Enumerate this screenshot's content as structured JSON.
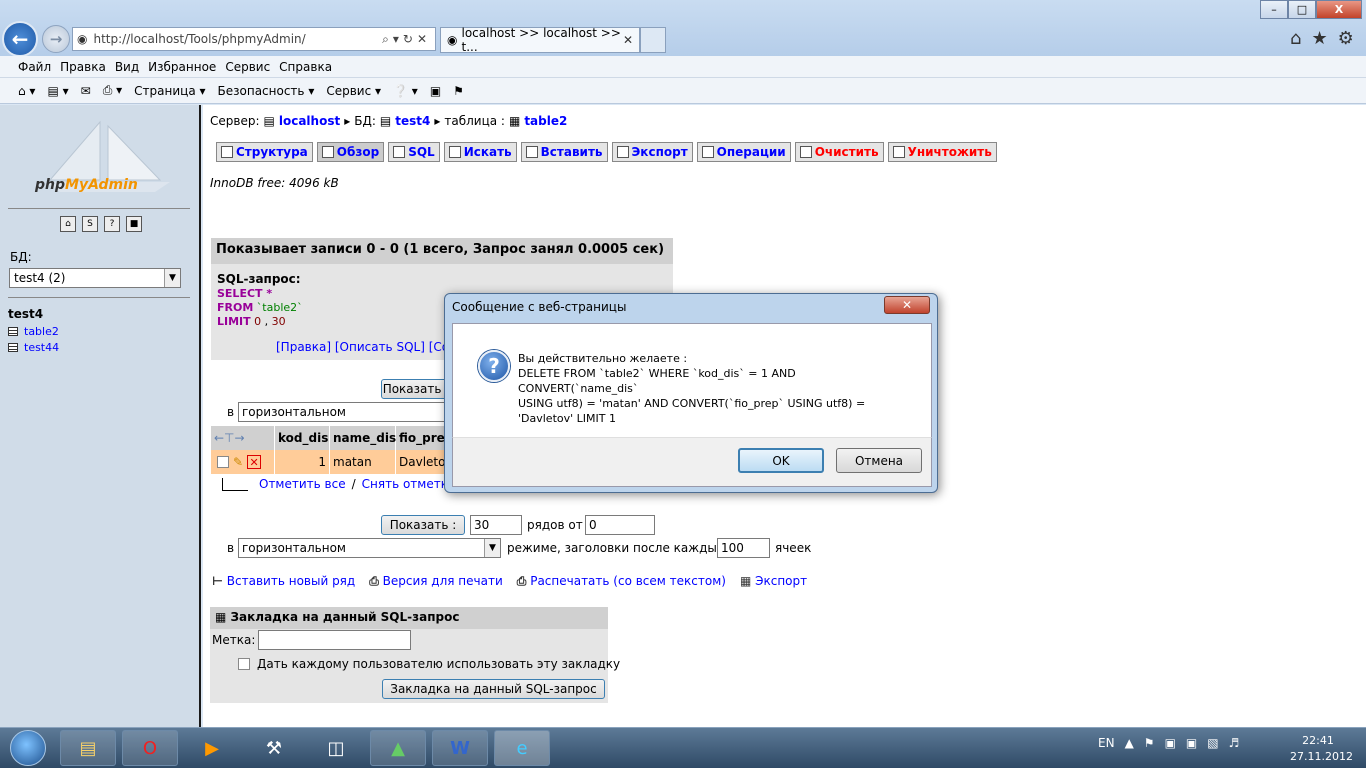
{
  "browser": {
    "address_url": "http://localhost/Tools/phpmyAdmin/",
    "tab_title": "localhost >> localhost >> t...",
    "window_controls": {
      "minimize": "–",
      "maximize": "□",
      "close": "X"
    }
  },
  "menu": [
    "Файл",
    "Правка",
    "Вид",
    "Избранное",
    "Сервис",
    "Справка"
  ],
  "toolbar": [
    "Страница ▾",
    "Безопасность ▾",
    "Сервис ▾"
  ],
  "sidebar": {
    "logo": "php",
    "logo_accent": "MyAdmin",
    "db_label": "БД:",
    "db_selected": "test4 (2)",
    "db_name": "test4",
    "tables": [
      "table2",
      "test44"
    ]
  },
  "main": {
    "breadcrumb": {
      "server_label": "Сервер:",
      "server": "localhost",
      "db_label": "БД:",
      "db": "test4",
      "table_label": "таблица :",
      "table": "table2"
    },
    "tabs": [
      "Структура",
      "Обзор",
      "SQL",
      "Искать",
      "Вставить",
      "Экспорт",
      "Операции",
      "Очистить",
      "Уничтожить"
    ],
    "innodb_free": "InnoDB free: 4096 kB",
    "result_header": "Показывает записи 0 - 0 (1 всего, Запрос занял 0.0005 сек)",
    "sql_label": "SQL-запрос:",
    "sql": {
      "select": "SELECT",
      "star": " *",
      "from": "FROM",
      "table": " `table2`",
      "limit": "LIMIT",
      "limit_vals_a": " 0",
      "limit_comma": " , ",
      "limit_vals_b": "30"
    },
    "sql_links": "[Правка] [Описать SQL] [Со",
    "show_button": "Показать :",
    "mode_prefix": "в",
    "mode_value": "горизонтальном",
    "columns": [
      "kod_dis",
      "name_dis",
      "fio_pre"
    ],
    "row": {
      "kod_dis": "1",
      "name_dis": "matan",
      "fio_prep": "Davleto"
    },
    "select_all": "Отметить все",
    "separator": "/",
    "select_partial": "Снять отметк",
    "rows_value": "30",
    "rows_label": "рядов от",
    "from_value": "0",
    "mode_suffix": "режиме, заголовки после каждых",
    "headers_value": "100",
    "cells_label": "ячеек",
    "actions": [
      "Вставить новый ряд",
      "Версия для печати",
      "Распечатать (со всем текстом)",
      "Экспорт"
    ],
    "bookmark": {
      "header": "Закладка на данный SQL-запрос",
      "label": "Метка:",
      "checkbox_label": "Дать каждому пользователю использовать эту закладку",
      "button": "Закладка на данный SQL-запрос"
    }
  },
  "dialog": {
    "title": "Сообщение с веб-страницы",
    "message": "Вы действительно желаете  :\nDELETE FROM `table2` WHERE `kod_dis` = 1 AND CONVERT(`name_dis`\nUSING utf8) = 'matan' AND CONVERT(`fio_prep` USING utf8) =\n'Davletov' LIMIT 1",
    "ok": "OK",
    "cancel": "Отмена"
  },
  "taskbar": {
    "lang": "EN",
    "time": "22:41",
    "date": "27.11.2012"
  },
  "colors": {
    "link": "#0000ff",
    "row_highlight": "#ffcc99",
    "danger": "#ff0000",
    "sql_keyword": "#990099"
  }
}
